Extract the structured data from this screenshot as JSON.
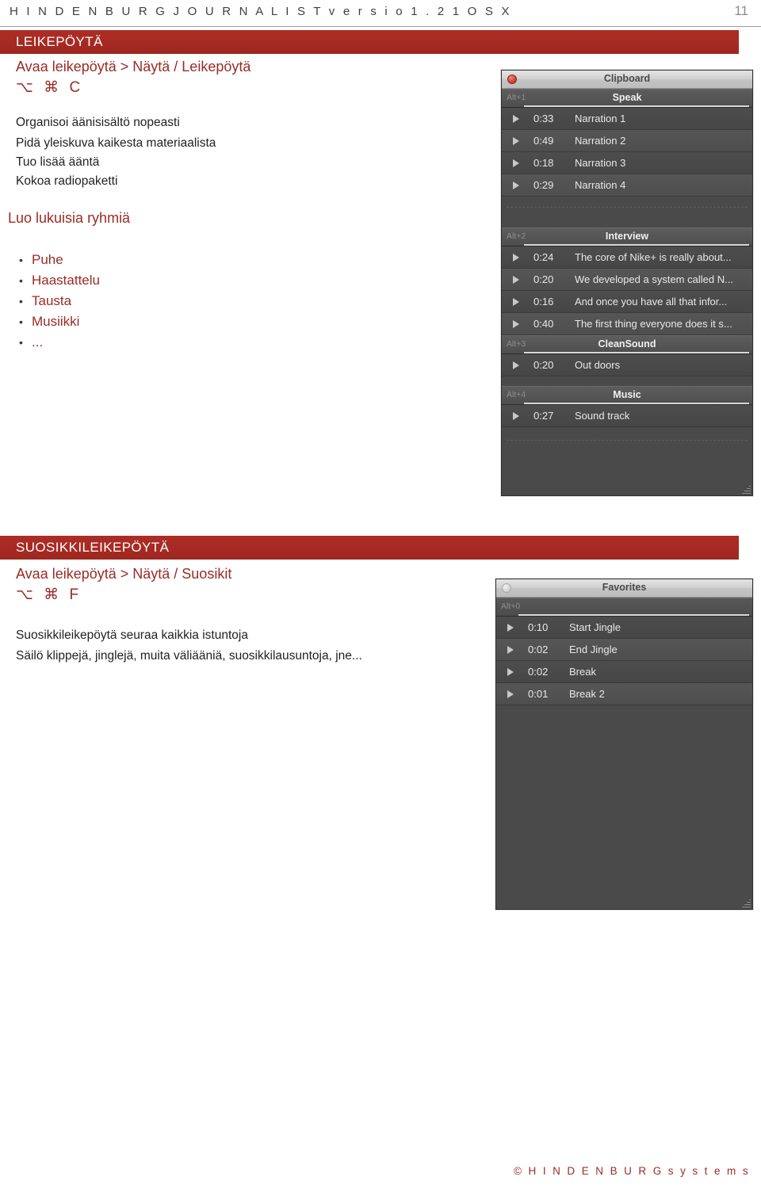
{
  "header": {
    "title": "H I N D E N B U R G   J O U R N A L I S T   v e r s i o   1 . 2 1   O S   X",
    "page_number": "11"
  },
  "sections": [
    {
      "bar_title": "LEIKEPÖYTÄ",
      "menu_path": "Avaa leikepöytä > Näytä / Leikepöytä",
      "shortcut": "⌥ ⌘ C",
      "lines": [
        "Organisoi äänisisältö nopeasti",
        "Pidä yleiskuva kaikesta materiaalista",
        "Tuo lisää ääntä",
        "Kokoa radiopaketti"
      ],
      "sub_heading": "Luo lukuisia ryhmiä",
      "bullets": [
        "Puhe",
        "Haastattelu",
        "Tausta",
        "Musiikki",
        "..."
      ]
    },
    {
      "bar_title": "SUOSIKKILEIKEPÖYTÄ",
      "menu_path": "Avaa leikepöytä > Näytä / Suosikit",
      "shortcut": "⌥ ⌘ F",
      "lines": [
        "Suosikkileikepöytä seuraa kaikkia istuntoja",
        "Säilö klippejä, jinglejä, muita väliääniä, suosikkilausuntoja, jne..."
      ]
    }
  ],
  "clipboard_window": {
    "title": "Clipboard",
    "close_button_name": "close-button",
    "groups": [
      {
        "key": "Alt+1",
        "label": "Speak",
        "clips": []
      },
      {
        "key": "Alt+1",
        "label": "",
        "clips": [
          {
            "time": "0:33",
            "name": "Narration 1"
          },
          {
            "time": "0:49",
            "name": "Narration 2"
          },
          {
            "time": "0:18",
            "name": "Narration 3"
          },
          {
            "time": "0:29",
            "name": "Narration 4"
          }
        ]
      },
      {
        "key": "Alt+2",
        "label": "Interview",
        "clips": [
          {
            "time": "0:24",
            "name": "The core of Nike+ is really about..."
          },
          {
            "time": "0:20",
            "name": "We developed a system called N..."
          },
          {
            "time": "0:16",
            "name": "And once you have all that infor..."
          },
          {
            "time": "0:40",
            "name": "The first thing everyone does it s..."
          }
        ]
      },
      {
        "key": "Alt+3",
        "label": "CleanSound",
        "clips": [
          {
            "time": "0:20",
            "name": "Out doors"
          }
        ]
      },
      {
        "key": "Alt+4",
        "label": "Music",
        "clips": [
          {
            "time": "0:27",
            "name": "Sound track"
          }
        ]
      }
    ]
  },
  "favorites_window": {
    "title": "Favorites",
    "group_key": "Alt+0",
    "clips": [
      {
        "time": "0:10",
        "name": "Start Jingle"
      },
      {
        "time": "0:02",
        "name": "End Jingle"
      },
      {
        "time": "0:02",
        "name": "Break"
      },
      {
        "time": "0:01",
        "name": "Break 2"
      }
    ]
  },
  "footer": {
    "text": "© H I N D E N B U R G  s y s t e m s"
  }
}
